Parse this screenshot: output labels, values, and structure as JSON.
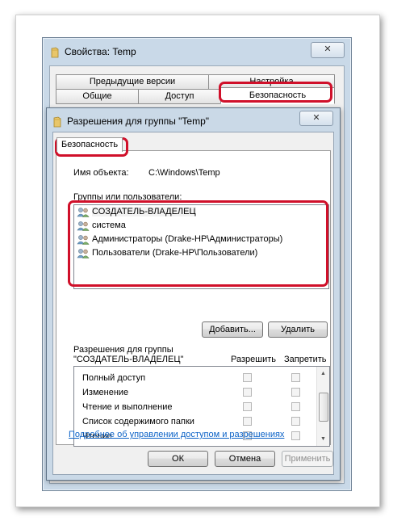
{
  "properties_window": {
    "title": "Свойства: Temp",
    "close_label": "✕",
    "tabs_row1": [
      "Предыдущие версии",
      "Настройка"
    ],
    "tabs_row2": [
      "Общие",
      "Доступ",
      "Безопасность"
    ]
  },
  "permissions_dialog": {
    "title": "Разрешения для группы \"Temp\"",
    "close_label": "✕",
    "tab_label": "Безопасность",
    "object_name_label": "Имя объекта:",
    "object_name_value": "C:\\Windows\\Temp",
    "groups_label": "Группы или пользователи:",
    "groups": [
      {
        "name": "СОЗДАТЕЛЬ-ВЛАДЕЛЕЦ",
        "selected": true
      },
      {
        "name": "система",
        "selected": false
      },
      {
        "name": "Администраторы (Drake-HP\\Администраторы)",
        "selected": false
      },
      {
        "name": "Пользователи (Drake-HP\\Пользователи)",
        "selected": false
      }
    ],
    "add_button": "Добавить...",
    "remove_button": "Удалить",
    "permissions_for_label_line1": "Разрешения для группы",
    "permissions_for_label_line2": "\"СОЗДАТЕЛЬ-ВЛАДЕЛЕЦ\"",
    "allow_header": "Разрешить",
    "deny_header": "Запретить",
    "permissions": [
      {
        "name": "Полный доступ",
        "allow": false,
        "deny": false
      },
      {
        "name": "Изменение",
        "allow": false,
        "deny": false
      },
      {
        "name": "Чтение и выполнение",
        "allow": false,
        "deny": false
      },
      {
        "name": "Список содержимого папки",
        "allow": false,
        "deny": false
      },
      {
        "name": "Чтение",
        "allow": false,
        "deny": false
      }
    ],
    "help_link": "Подробнее об управлении доступом и разрешениях",
    "ok_button": "ОК",
    "cancel_button": "Отмена",
    "apply_button": "Применить"
  },
  "colors": {
    "highlight": "#d0102a",
    "link": "#0b62c7",
    "titlebar": "#c9d9e8"
  }
}
